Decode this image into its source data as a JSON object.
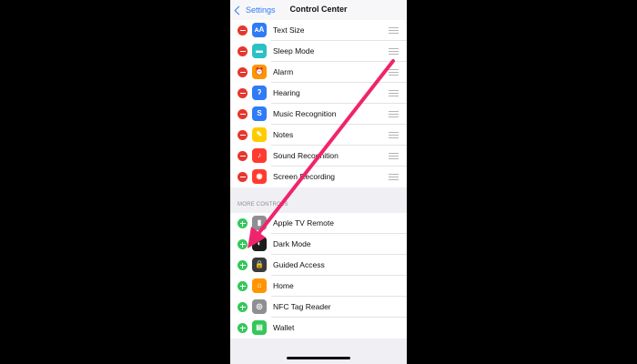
{
  "header": {
    "back_label": "Settings",
    "title": "Control Center"
  },
  "included_controls": [
    {
      "label": "Text Size",
      "icon": "text-size-icon",
      "glyph": "ᴀA",
      "color": "#2f7cf6"
    },
    {
      "label": "Sleep Mode",
      "icon": "bed-icon",
      "glyph": "▬",
      "color": "#2bc0c6"
    },
    {
      "label": "Alarm",
      "icon": "alarm-clock-icon",
      "glyph": "⏰",
      "color": "#ff9500"
    },
    {
      "label": "Hearing",
      "icon": "ear-icon",
      "glyph": "ʔ",
      "color": "#2f7cf6"
    },
    {
      "label": "Music Recognition",
      "icon": "shazam-icon",
      "glyph": "S",
      "color": "#2f7cf6"
    },
    {
      "label": "Notes",
      "icon": "notes-icon",
      "glyph": "✎",
      "color": "#ffcc00"
    },
    {
      "label": "Sound Recognition",
      "icon": "sound-recognition-icon",
      "glyph": "♪",
      "color": "#ff3b30"
    },
    {
      "label": "Screen Recording",
      "icon": "record-icon",
      "glyph": "◉",
      "color": "#ff3b30"
    }
  ],
  "more_controls": {
    "header": "MORE CONTROLS",
    "items": [
      {
        "label": "Apple TV Remote",
        "icon": "remote-icon",
        "glyph": "▮",
        "color": "#8e8e93"
      },
      {
        "label": "Dark Mode",
        "icon": "dark-mode-icon",
        "glyph": "◐",
        "color": "#1c1c1e"
      },
      {
        "label": "Guided Access",
        "icon": "lock-icon",
        "glyph": "🔒",
        "color": "#3a3a3c"
      },
      {
        "label": "Home",
        "icon": "home-icon",
        "glyph": "⌂",
        "color": "#ff9500"
      },
      {
        "label": "NFC Tag Reader",
        "icon": "nfc-icon",
        "glyph": "◎",
        "color": "#8e8e93"
      },
      {
        "label": "Wallet",
        "icon": "wallet-icon",
        "glyph": "▤",
        "color": "#34c759"
      }
    ]
  },
  "colors": {
    "accent": "#2f7cf6",
    "remove": "#e5372e",
    "add": "#34c759",
    "arrow": "#f0246a"
  }
}
